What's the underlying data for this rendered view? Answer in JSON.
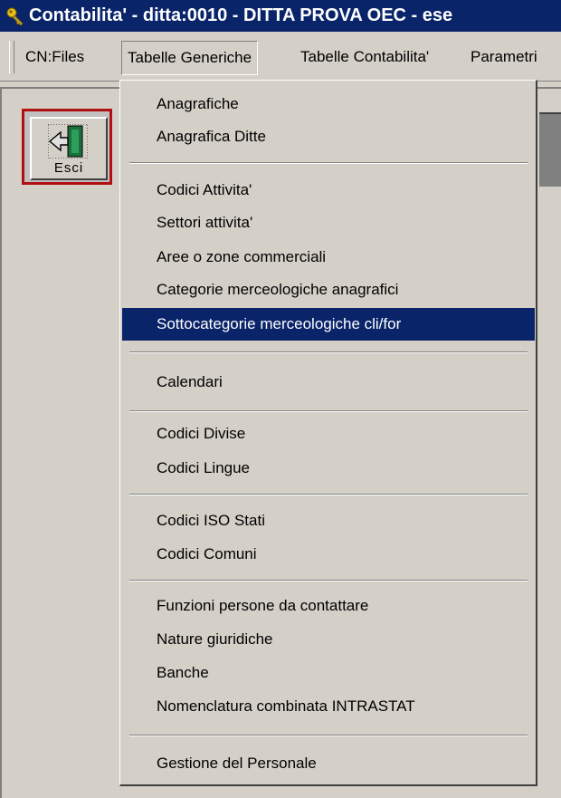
{
  "window": {
    "title": "Contabilita' - ditta:0010 - DITTA PROVA OEC - ese"
  },
  "menubar": {
    "items": [
      {
        "label": "CN:Files"
      },
      {
        "label": "Tabelle Generiche"
      },
      {
        "label": "Tabelle Contabilita'"
      },
      {
        "label": "Parametri"
      }
    ],
    "open_menu": "Tabelle Generiche"
  },
  "toolbar": {
    "exit_label": "Esci",
    "exit_icon": "door-exit-icon"
  },
  "dropdown": {
    "items": [
      {
        "label": "Anagrafiche"
      },
      {
        "label": "Anagrafica Ditte"
      },
      {
        "label": "Codici Attivita'"
      },
      {
        "label": "Settori attivita'"
      },
      {
        "label": "Aree o zone commerciali"
      },
      {
        "label": "Categorie merceologiche anagrafici"
      },
      {
        "label": "Sottocategorie merceologiche cli/for"
      },
      {
        "label": "Calendari"
      },
      {
        "label": "Codici Divise"
      },
      {
        "label": "Codici Lingue"
      },
      {
        "label": "Codici ISO Stati"
      },
      {
        "label": "Codici Comuni"
      },
      {
        "label": "Funzioni persone da contattare"
      },
      {
        "label": "Nature giuridiche"
      },
      {
        "label": "Banche"
      },
      {
        "label": "Nomenclatura combinata INTRASTAT"
      },
      {
        "label": "Gestione del Personale"
      }
    ],
    "highlighted": "Sottocategorie merceologiche cli/for"
  },
  "colors": {
    "titlebar": "#0a246a",
    "highlight": "#0a246a",
    "face": "#d4d0c8",
    "exit_border": "#b01010"
  }
}
